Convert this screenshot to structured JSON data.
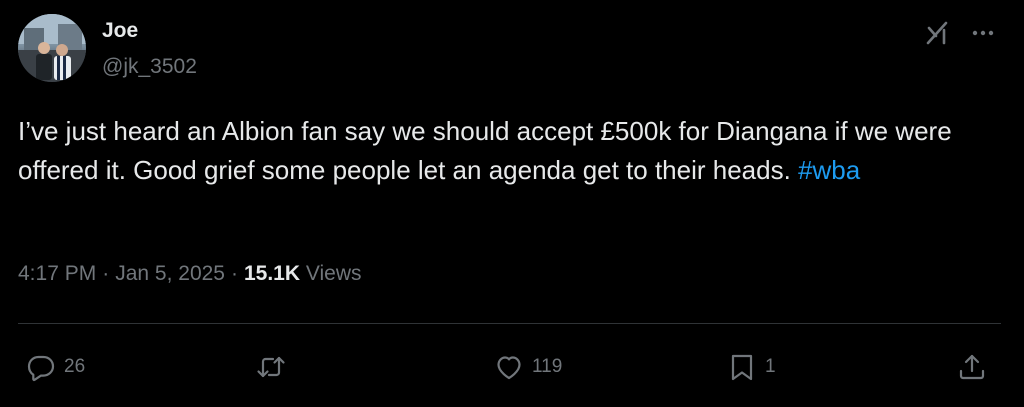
{
  "author": {
    "display_name": "Joe",
    "handle": "@jk_3502"
  },
  "tweet": {
    "text": "I’ve just heard an Albion fan say we should accept £500k for Diangana if we were offered it. Good grief some people let an agenda get to their heads. ",
    "hashtag": "#wba"
  },
  "meta": {
    "time": "4:17 PM",
    "separator": "·",
    "date": "Jan 5, 2025",
    "views_count": "15.1K",
    "views_label": "Views"
  },
  "actions": {
    "replies": "26",
    "retweets": "",
    "likes": "119",
    "bookmarks": "1"
  },
  "colors": {
    "background": "#000000",
    "text_primary": "#e7e9ea",
    "text_secondary": "#71767b",
    "link": "#1d9bf0",
    "divider": "#2f3336"
  },
  "icons": [
    "grok-icon",
    "more-icon",
    "reply-icon",
    "retweet-icon",
    "like-icon",
    "bookmark-icon",
    "share-icon"
  ]
}
